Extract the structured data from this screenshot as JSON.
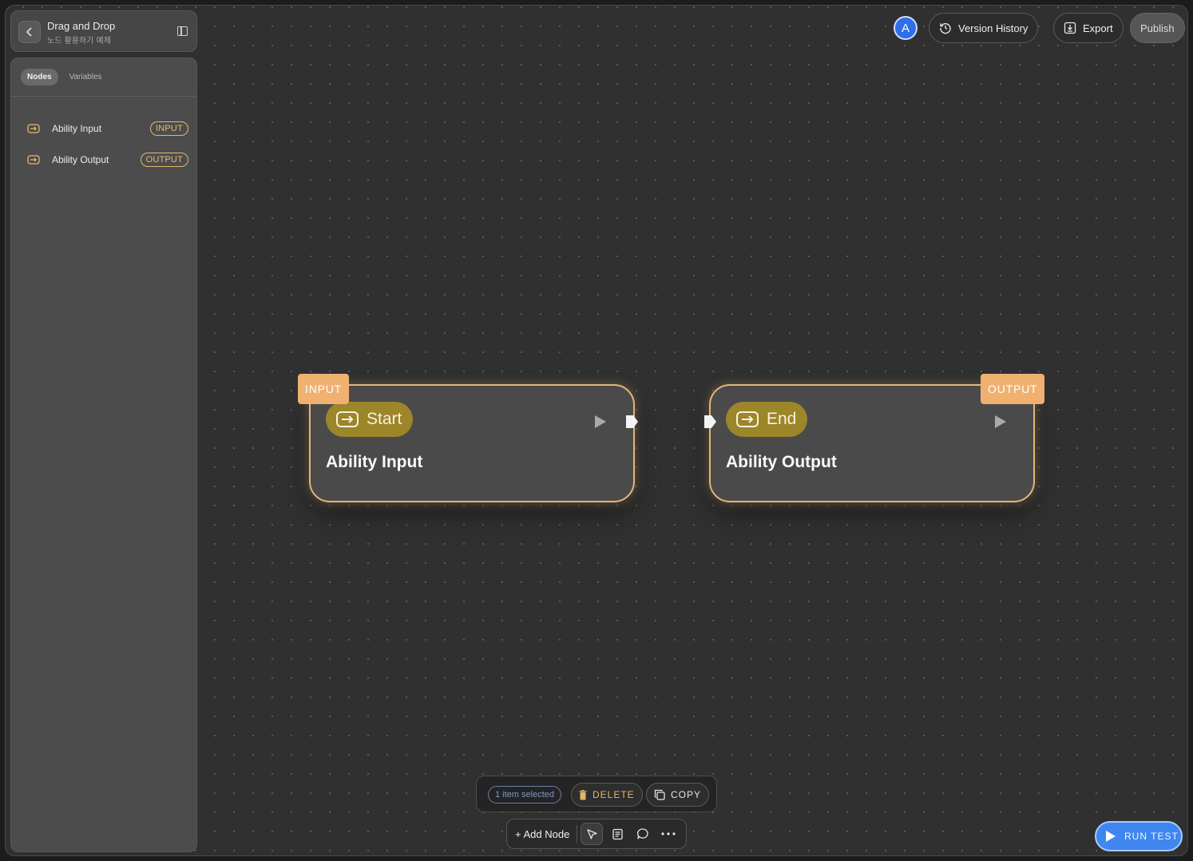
{
  "header": {
    "title": "Drag and Drop",
    "subtitle": "노드 활용하기 예제"
  },
  "sidebar": {
    "tabs": [
      {
        "label": "Nodes",
        "active": true
      },
      {
        "label": "Variables",
        "active": false
      }
    ],
    "items": [
      {
        "label": "Ability Input",
        "tag": "INPUT",
        "icon": "enter-arrow-icon"
      },
      {
        "label": "Ability Output",
        "tag": "OUTPUT",
        "icon": "enter-arrow-icon"
      }
    ]
  },
  "topbar": {
    "avatar_letter": "A",
    "version_history": "Version History",
    "export": "Export",
    "publish": "Publish"
  },
  "nodes": [
    {
      "tag": "INPUT",
      "pill": "Start",
      "title": "Ability Input"
    },
    {
      "tag": "OUTPUT",
      "pill": "End",
      "title": "Ability Output"
    }
  ],
  "selection": {
    "count_text": "1 item selected",
    "delete": "DELETE",
    "copy": "COPY"
  },
  "toolbar": {
    "add_node": "+ Add Node",
    "tools": [
      "pointer-icon",
      "note-icon",
      "comment-icon",
      "more-icon"
    ]
  },
  "run_test": "RUN TEST",
  "colors": {
    "accent_orange": "#f0b070",
    "node_border": "#e2b677",
    "pill_gold": "#9d8529",
    "run_blue": "#3f86f0",
    "avatar_blue": "#2f6fe8"
  }
}
